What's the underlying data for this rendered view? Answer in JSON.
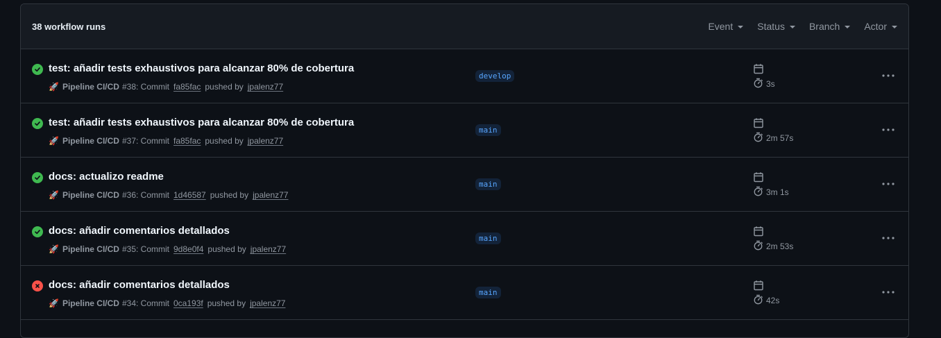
{
  "header": {
    "count_label": "38 workflow runs",
    "filters": [
      {
        "label": "Event"
      },
      {
        "label": "Status"
      },
      {
        "label": "Branch"
      },
      {
        "label": "Actor"
      }
    ]
  },
  "colors": {
    "success": "#3fb950",
    "failure": "#f85149",
    "branch_text": "#58a6ff"
  },
  "runs": [
    {
      "status": "success",
      "title": "test: añadir tests exhaustivos para alcanzar 80% de cobertura",
      "workflow": "Pipeline CI/CD",
      "run_info": "#38: Commit",
      "commit": "fa85fac",
      "pushed_by": "pushed by",
      "actor": "jpalenz77",
      "branch": "develop",
      "duration": "3s"
    },
    {
      "status": "success",
      "title": "test: añadir tests exhaustivos para alcanzar 80% de cobertura",
      "workflow": "Pipeline CI/CD",
      "run_info": "#37: Commit",
      "commit": "fa85fac",
      "pushed_by": "pushed by",
      "actor": "jpalenz77",
      "branch": "main",
      "duration": "2m 57s"
    },
    {
      "status": "success",
      "title": "docs: actualizo readme",
      "workflow": "Pipeline CI/CD",
      "run_info": "#36: Commit",
      "commit": "1d46587",
      "pushed_by": "pushed by",
      "actor": "jpalenz77",
      "branch": "main",
      "duration": "3m 1s"
    },
    {
      "status": "success",
      "title": "docs: añadir comentarios detallados",
      "workflow": "Pipeline CI/CD",
      "run_info": "#35: Commit",
      "commit": "9d8e0f4",
      "pushed_by": "pushed by",
      "actor": "jpalenz77",
      "branch": "main",
      "duration": "2m 53s"
    },
    {
      "status": "failure",
      "title": "docs: añadir comentarios detallados",
      "workflow": "Pipeline CI/CD",
      "run_info": "#34: Commit",
      "commit": "0ca193f",
      "pushed_by": "pushed by",
      "actor": "jpalenz77",
      "branch": "main",
      "duration": "42s"
    }
  ]
}
